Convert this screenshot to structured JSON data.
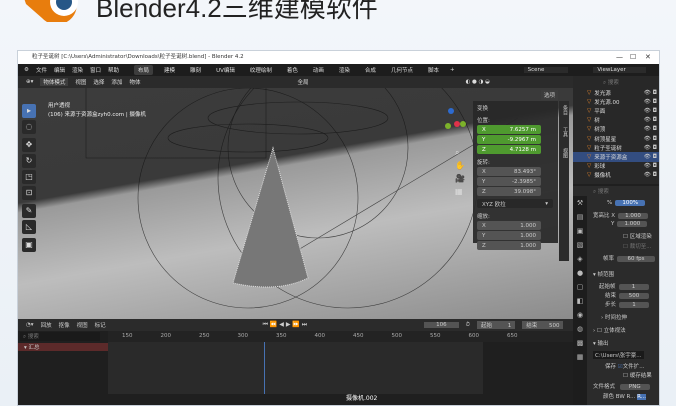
{
  "page": {
    "title": "Blender4.2三维建模软件"
  },
  "window": {
    "title": "粒子圣诞树 [C:\\Users\\Administrator\\Downloads\\粒子圣诞树.blend] - Blender 4.2",
    "controls": [
      "—",
      "☐",
      "✕"
    ]
  },
  "menubar": {
    "menus": [
      "文件",
      "编辑",
      "渲染",
      "窗口",
      "帮助"
    ],
    "workspaces": [
      "布局",
      "建模",
      "雕刻",
      "UV编辑",
      "纹理绘制",
      "着色",
      "动画",
      "渲染",
      "合成",
      "几何节点",
      "脚本",
      "+"
    ],
    "active_workspace": "布局",
    "scene": "Scene",
    "view_layer": "ViewLayer"
  },
  "viewport_header": {
    "mode": "物体模式",
    "menus": [
      "视图",
      "选择",
      "添加",
      "物体"
    ],
    "transform_orientation": "全局",
    "options_label": "选项"
  },
  "viewport": {
    "view_name": "用户透视",
    "info": "(106) 来源于资源盒zyh0.com | 摄像机"
  },
  "npanel": {
    "header": "变换",
    "location_label": "位置:",
    "location": [
      "7.6257 m",
      "-9.2967 m",
      "4.7128 m"
    ],
    "rotation_label": "旋转:",
    "rotation": [
      "83.493°",
      "-2.3985°",
      "39.098°"
    ],
    "rotation_mode": "XYZ 欧拉",
    "scale_label": "缩放:",
    "scale": [
      "1.000",
      "1.000",
      "1.000"
    ],
    "axes": [
      "X",
      "Y",
      "Z"
    ],
    "tabs": [
      "条目",
      "工具",
      "视图"
    ]
  },
  "outliner": {
    "search_placeholder": "搜索",
    "items": [
      "发光源",
      "发光源.00",
      "平面",
      "树",
      "树顶",
      "树顶星星",
      "粒子圣诞树",
      "来源于资源盒",
      "彩球",
      "摄像机"
    ],
    "highlighted": "来源于资源盒"
  },
  "properties": {
    "search_placeholder": "搜索",
    "percent": "100%",
    "aspect_x_label": "宽高比 X",
    "aspect_x": "1.000",
    "aspect_y_label": "Y",
    "aspect_y": "1.000",
    "region_render": "区域渲染",
    "crop": "裁切至...",
    "fps_label": "帧率",
    "fps": "60 fps",
    "frame_range": "帧范围",
    "start_label": "起始帧",
    "start": "1",
    "end_label": "结束",
    "end": "500",
    "step_label": "步长",
    "step": "1",
    "time_stretch": "时间拉伸",
    "stereo": "立体视法",
    "output": "输出",
    "output_path": "C:\\Users\\张宇豪...",
    "save_label": "保存",
    "file_ext": "文件扩...",
    "cache_result": "缓存结果",
    "file_format_label": "文件格式",
    "file_format": "PNG",
    "color_label": "颜色",
    "color_modes": [
      "BW",
      "R...",
      "R..."
    ]
  },
  "timeline": {
    "menus": [
      "回放",
      "抠像",
      "视图",
      "标记"
    ],
    "current_frame": "106",
    "start_label": "起始",
    "start": "1",
    "end_label": "结束",
    "end": "500",
    "search_placeholder": "搜索",
    "summary": "汇总",
    "ticks": [
      "150",
      "200",
      "250",
      "300",
      "350",
      "400",
      "450",
      "500",
      "550",
      "600",
      "650"
    ],
    "marker": "摄像机.002"
  }
}
